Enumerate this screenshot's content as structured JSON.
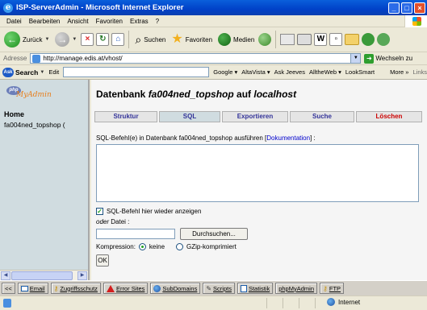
{
  "window": {
    "title": "ISP-ServerAdmin - Microsoft Internet Explorer",
    "buttons": [
      "_",
      "□",
      "×"
    ]
  },
  "menubar": {
    "items": [
      "Datei",
      "Bearbeiten",
      "Ansicht",
      "Favoriten",
      "Extras",
      "?"
    ]
  },
  "toolbar": {
    "back_label": "Zurück",
    "search_label": "Suchen",
    "favorites_label": "Favoriten",
    "media_label": "Medien"
  },
  "addressbar": {
    "label": "Adresse",
    "url": "http://manage.edis.at/vhost/",
    "go_label": "Wechseln zu"
  },
  "googlebar": {
    "brand": "Search",
    "edit_label": "Edit",
    "items": [
      "Google ▾",
      "AltaVista ▾",
      "Ask Jeeves",
      "AlltheWeb ▾",
      "LookSmart"
    ],
    "more_label": "More »",
    "links_label": "Links"
  },
  "leftframe": {
    "logo_php": "php",
    "logo_text": "MyAdmin",
    "home_label": "Home",
    "database_label": "fa004ned_topshop  ("
  },
  "main": {
    "title_prefix": "Datenbank ",
    "db_name": "fa004ned_topshop",
    "title_mid": " auf ",
    "host": "localhost",
    "tabs": [
      {
        "label": "Struktur"
      },
      {
        "label": "SQL"
      },
      {
        "label": "Exportieren"
      },
      {
        "label": "Suche"
      },
      {
        "label": "Löschen"
      }
    ],
    "sql_label_prefix": "SQL-Befehl(e) in Datenbank fa004ned_topshop ausführen [",
    "doc_link": "Dokumentation",
    "sql_label_suffix": "] :",
    "sql_value": "",
    "show_again_label": "SQL-Befehl hier wieder anzeigen",
    "show_again_checked": true,
    "or_label": "oder",
    "file_label": " Datei :",
    "file_value": "",
    "browse_label": "Durchsuchen...",
    "compression_label": "Kompression:",
    "compression_options": [
      "keine",
      "GZip-komprimiert"
    ],
    "compression_selected": "keine",
    "ok_label": "OK"
  },
  "linkbar": {
    "nav_label": "<<",
    "items": [
      {
        "label": "Email",
        "icon": "envelope-icon"
      },
      {
        "label": "Zugriffsschutz",
        "icon": "key-icon"
      },
      {
        "label": "Error Sites",
        "icon": "warning-icon"
      },
      {
        "label": "SubDomains",
        "icon": "globe-icon"
      },
      {
        "label": "Scripts",
        "icon": "script-icon"
      },
      {
        "label": "Statistik",
        "icon": "stats-icon"
      },
      {
        "label": "phpMyAdmin",
        "icon": ""
      },
      {
        "label": "FTP",
        "icon": "ftp-icon"
      }
    ]
  },
  "statusbar": {
    "zone": "Internet"
  },
  "colors": {
    "titlebar": "#0A5FDB",
    "left_frame": "#D0DCE0",
    "tab_text": "#333399",
    "danger": "#CC0000",
    "link": "#0000CC"
  }
}
